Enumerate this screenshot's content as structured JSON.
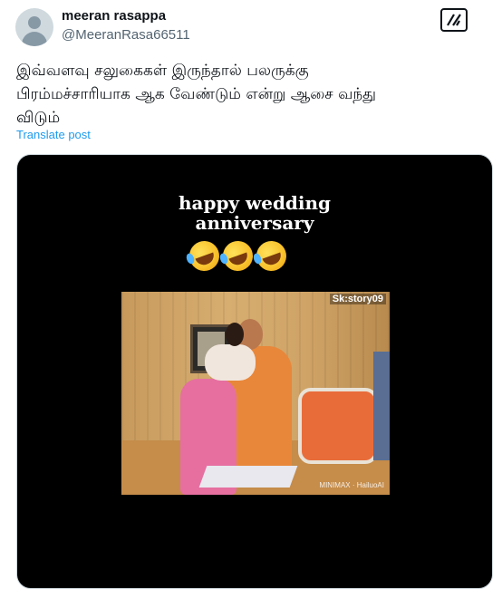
{
  "author": {
    "display_name": "meeran rasappa",
    "handle": "@MeeranRasa66511"
  },
  "grok_icon": "grok-icon",
  "tweet": {
    "text": "இவ்வளவு சலுகைகள் இருந்தால் பலருக்கு\nபிரம்மச்சாரியாக  ஆக வேண்டும் என்று ஆசை வந்து\nவிடும்",
    "translate_label": "Translate post"
  },
  "media": {
    "overlay_line1": "happy wedding",
    "overlay_line2": "anniversary",
    "watermark_top": "Sk:story09",
    "watermark_bottom": "MINIMAX · HailuoAI"
  },
  "colors": {
    "link": "#1d9bf0",
    "secondary_text": "#536471",
    "media_background": "#000000"
  }
}
